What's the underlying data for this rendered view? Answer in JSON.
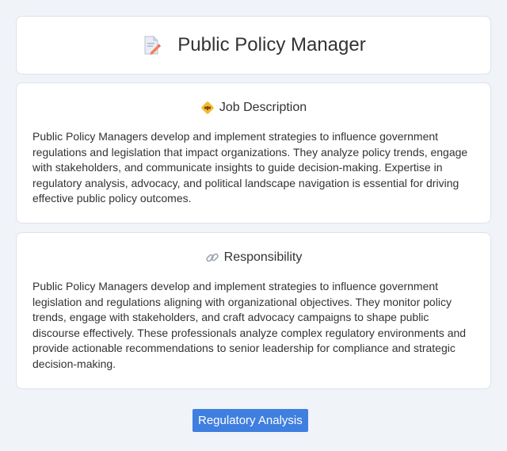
{
  "header": {
    "title": "Public Policy Manager",
    "icon": "document-edit-icon"
  },
  "job_description": {
    "heading": "Job Description",
    "icon": "diamond-badge-icon",
    "text": "Public Policy Managers develop and implement strategies to influence government regulations and legislation that impact organizations. They analyze policy trends, engage with stakeholders, and communicate insights to guide decision-making. Expertise in regulatory analysis, advocacy, and political landscape navigation is essential for driving effective public policy outcomes."
  },
  "responsibility": {
    "heading": "Responsibility",
    "icon": "link-icon",
    "text": "Public Policy Managers develop and implement strategies to influence government legislation and regulations aligning with organizational objectives. They monitor policy trends, engage with stakeholders, and craft advocacy campaigns to shape public discourse effectively. These professionals analyze complex regulatory environments and provide actionable recommendations to senior leadership for compliance and strategic decision-making."
  },
  "tags": {
    "primary_label": "Regulatory Analysis"
  },
  "colors": {
    "background": "#f0f3f8",
    "card": "#ffffff",
    "accent": "#3f7fe0",
    "text": "#333333"
  }
}
